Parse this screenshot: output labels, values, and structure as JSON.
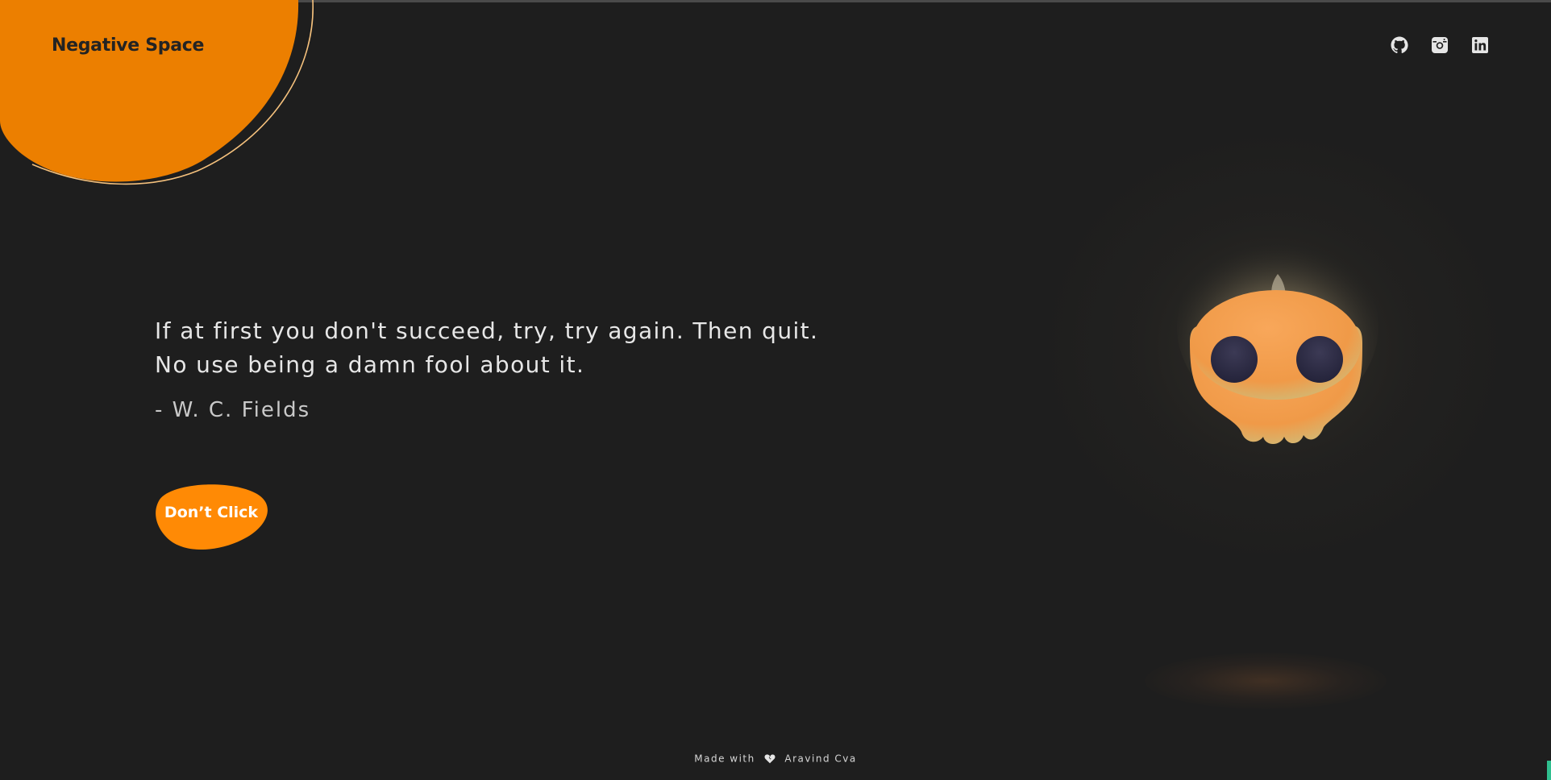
{
  "brand": {
    "name": "Negative Space",
    "accent_color": "#ef8506",
    "background_color": "#1e1e1e"
  },
  "social": [
    {
      "name": "github",
      "icon": "github-icon"
    },
    {
      "name": "instagram",
      "icon": "instagram-icon"
    },
    {
      "name": "linkedin",
      "icon": "linkedin-icon"
    }
  ],
  "quote": {
    "line1": "If at first you don't succeed, try, try again. Then quit.",
    "line2": "No use being a damn fool about it.",
    "author": "- W. C. Fields"
  },
  "cta": {
    "label": "Don’t Click"
  },
  "illustration": {
    "icon": "skull-icon"
  },
  "footer": {
    "made_with": "Made with",
    "icon": "broken-heart-icon",
    "author": "Aravind Cva"
  }
}
